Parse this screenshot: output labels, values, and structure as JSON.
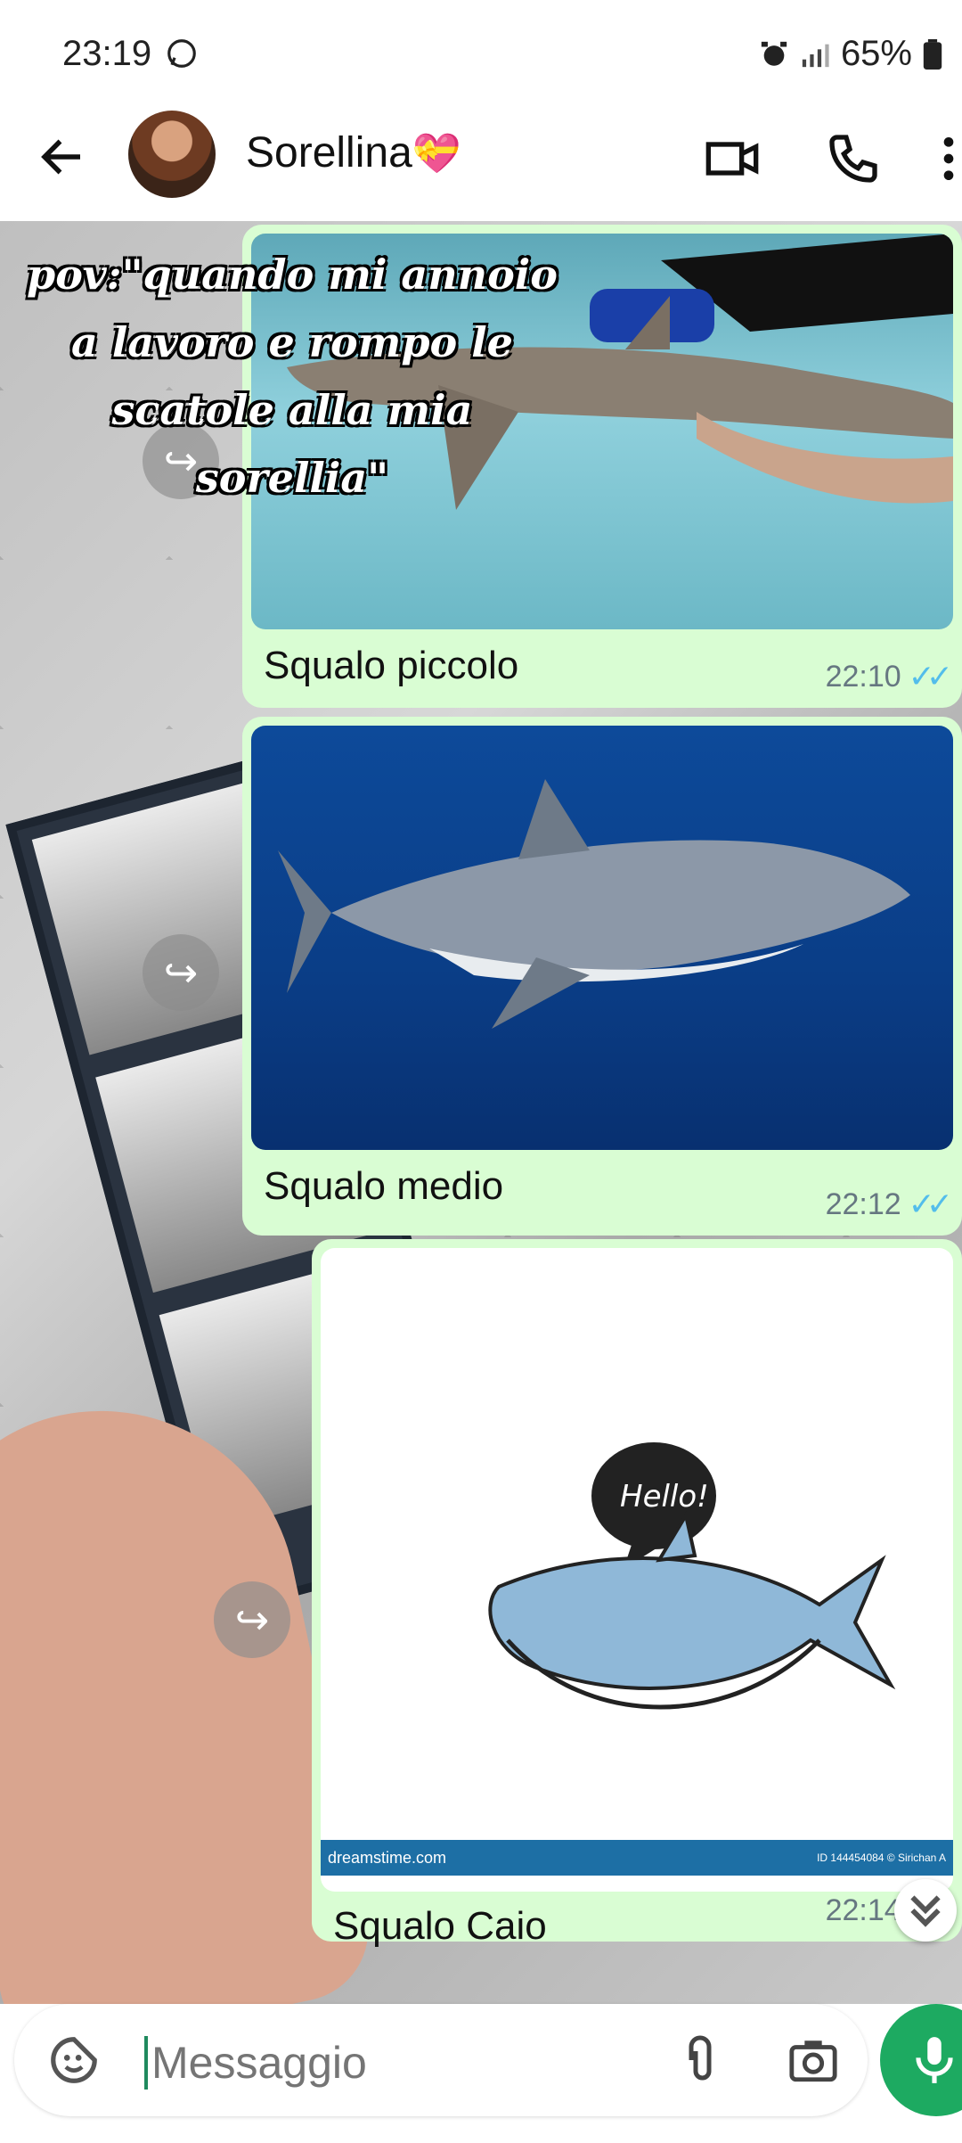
{
  "status_bar": {
    "time": "23:19",
    "battery": "65%"
  },
  "header": {
    "contact_name": "Sorellina",
    "heart_emoji": "💝"
  },
  "overlay_text": "pov:\"quando mi annoio a lavoro e rompo le scatole alla mia sorellia\"",
  "messages": [
    {
      "caption": "Squalo piccolo",
      "time": "22:10"
    },
    {
      "caption": "Squalo medio",
      "time": "22:12"
    },
    {
      "caption": "Squalo Caio",
      "time": "22:14",
      "sticker_text": "Hello!",
      "watermark": "dreamstime.com",
      "watermark_id": "ID 144454084 © Sirichan A"
    }
  ],
  "composer": {
    "placeholder": "Messaggio"
  },
  "colors": {
    "bubble": "#d9fdd3",
    "tick": "#53bdeb",
    "mic": "#1daa61"
  }
}
